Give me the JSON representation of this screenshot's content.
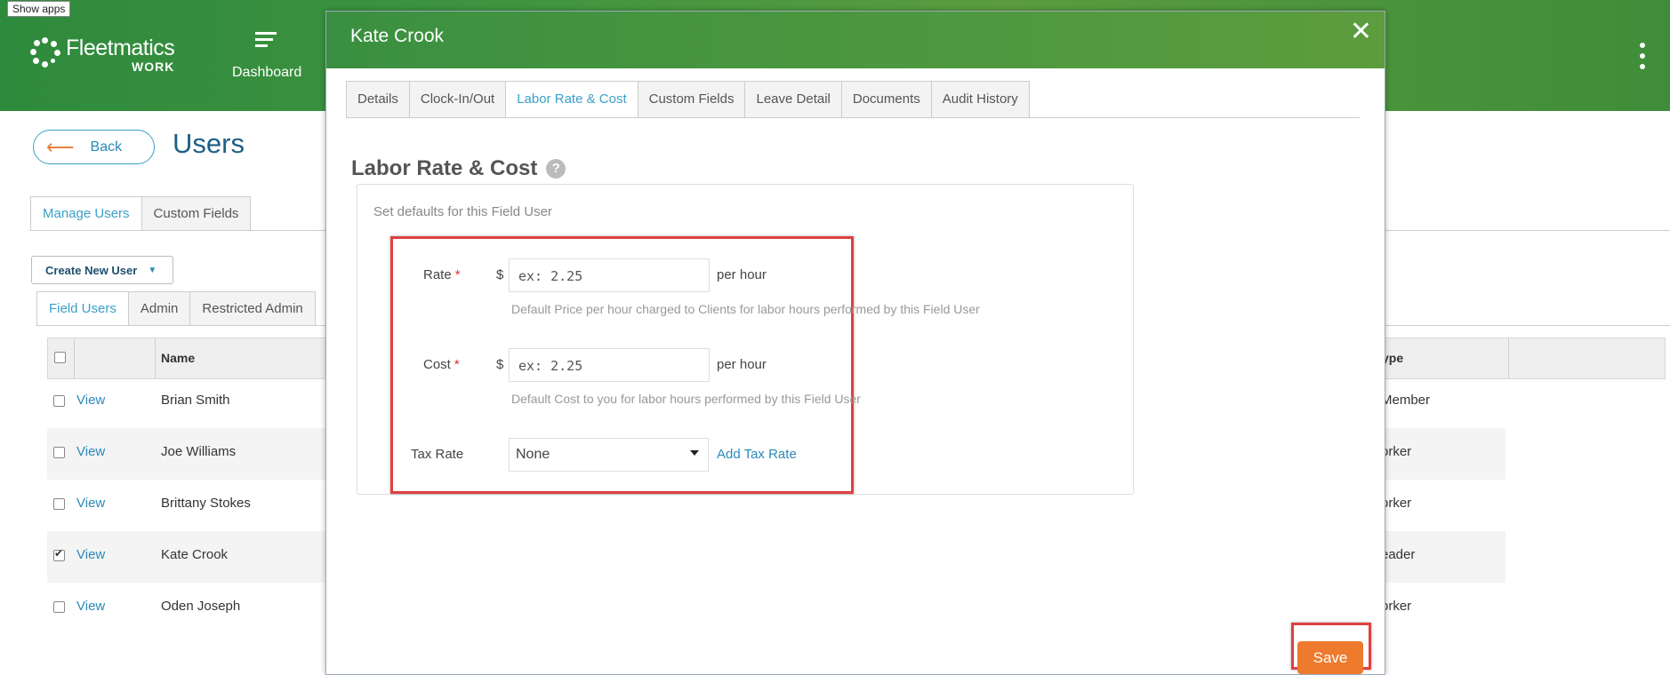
{
  "taskbar": {
    "show_apps": "Show apps"
  },
  "header": {
    "logo_line1": "Fleetmatics",
    "logo_line2": "WORK",
    "dashboard": "Dashboard"
  },
  "page": {
    "back": "Back",
    "title": "Users",
    "tabs": [
      "Manage Users",
      "Custom Fields"
    ],
    "create_button": "Create New User",
    "subtabs": [
      "Field Users",
      "Admin",
      "Restricted Admin"
    ],
    "table": {
      "headers": {
        "name": "Name",
        "type": "ype"
      },
      "rows": [
        {
          "view": "View",
          "name": "Brian Smith",
          "type": "Member",
          "checked": false
        },
        {
          "view": "View",
          "name": "Joe Williams",
          "type": "orker",
          "checked": false
        },
        {
          "view": "View",
          "name": "Brittany Stokes",
          "type": "orker",
          "checked": false
        },
        {
          "view": "View",
          "name": "Kate Crook",
          "type": "eader",
          "checked": true
        },
        {
          "view": "View",
          "name": "Oden Joseph",
          "type": "orker",
          "checked": false
        }
      ]
    }
  },
  "modal": {
    "title": "Kate Crook",
    "tabs": [
      "Details",
      "Clock-In/Out",
      "Labor Rate & Cost",
      "Custom Fields",
      "Leave Detail",
      "Documents",
      "Audit History"
    ],
    "active_tab": "Labor Rate & Cost",
    "section_title": "Labor Rate & Cost",
    "help": "?",
    "panel_description": "Set defaults for this Field User",
    "rate": {
      "label": "Rate",
      "required": "*",
      "currency": "$",
      "placeholder": "ex: 2.25",
      "unit": "per hour",
      "hint": "Default Price per hour charged to Clients for labor hours performed by this Field User"
    },
    "cost": {
      "label": "Cost",
      "required": "*",
      "currency": "$",
      "placeholder": "ex: 2.25",
      "unit": "per hour",
      "hint": "Default Cost to you for labor hours performed by this Field User"
    },
    "tax_rate": {
      "label": "Tax Rate",
      "selected": "None",
      "add_link": "Add Tax Rate"
    },
    "save": "Save"
  },
  "colors": {
    "header_green": "#3f9440",
    "link_blue": "#2a8ab8",
    "save_orange": "#ee7a2e",
    "highlight_red": "#e04040"
  }
}
